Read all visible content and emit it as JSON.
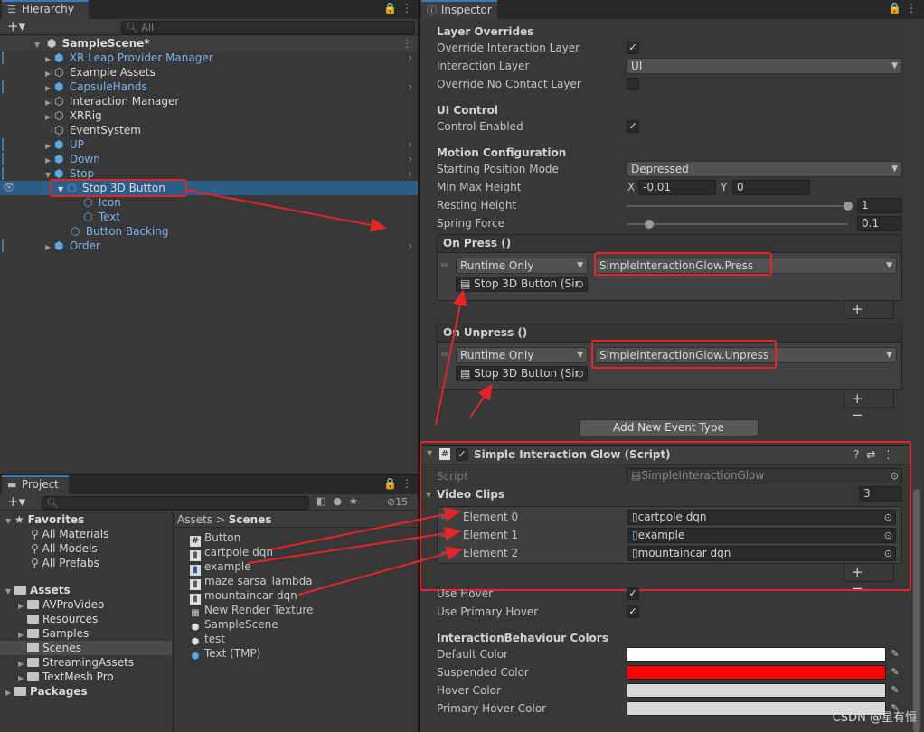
{
  "hierarchy": {
    "tab": "Hierarchy",
    "search_placeholder": "All",
    "scene": "SampleScene*",
    "items": [
      "XR Leap Provider Manager",
      "Example Assets",
      "CapsuleHands",
      "Interaction Manager",
      "XRRig",
      "EventSystem",
      "UP",
      "Down",
      "Stop",
      "Stop 3D Button",
      "Icon",
      "Text",
      "Button Backing",
      "Order"
    ]
  },
  "project": {
    "tab": "Project",
    "badge": "15",
    "favorites_label": "Favorites",
    "favorites": [
      "All Materials",
      "All Models",
      "All Prefabs"
    ],
    "assets_label": "Assets",
    "asset_folders": [
      "AVProVideo",
      "Resources",
      "Samples",
      "Scenes",
      "StreamingAssets",
      "TextMesh Pro"
    ],
    "packages_label": "Packages",
    "breadcrumb_root": "Assets",
    "breadcrumb_sep": ">",
    "breadcrumb_current": "Scenes",
    "files": [
      "Button",
      "cartpole dqn",
      "example",
      "maze sarsa_lambda",
      "mountaincar dqn",
      "New Render Texture",
      "SampleScene",
      "test",
      "Text (TMP)"
    ]
  },
  "inspector": {
    "tab": "Inspector",
    "layer_overrides": "Layer Overrides",
    "override_interaction_layer": "Override Interaction Layer",
    "interaction_layer": "Interaction Layer",
    "interaction_layer_value": "UI",
    "override_no_contact_layer": "Override No Contact Layer",
    "ui_control": "UI Control",
    "control_enabled": "Control Enabled",
    "motion_configuration": "Motion Configuration",
    "starting_position_mode": "Starting Position Mode",
    "starting_position_value": "Depressed",
    "min_max_height": "Min Max Height",
    "x_label": "X",
    "x_value": "-0.01",
    "y_label": "Y",
    "y_value": "0",
    "resting_height": "Resting Height",
    "resting_height_value": "1",
    "resting_height_fraction": 1.0,
    "spring_force": "Spring Force",
    "spring_force_value": "0.1",
    "spring_force_fraction": 0.1,
    "on_press": "On Press ()",
    "on_unpress": "On Unpress ()",
    "runtime_only": "Runtime Only",
    "press_function": "SimpleInteractionGlow.Press",
    "unpress_function": "SimpleInteractionGlow.Unpress",
    "target_object": "Stop 3D Button (Sir",
    "plus": "+",
    "minus": "−",
    "add_event_type": "Add New Event Type",
    "component_title": "Simple Interaction Glow (Script)",
    "script_label": "Script",
    "script_value": "SimpleInteractionGlow",
    "video_clips": "Video Clips",
    "video_clips_count": "3",
    "elements": [
      {
        "label": "Element 0",
        "value": "cartpole dqn"
      },
      {
        "label": "Element 1",
        "value": "example"
      },
      {
        "label": "Element 2",
        "value": "mountaincar dqn"
      }
    ],
    "use_hover": "Use Hover",
    "use_primary_hover": "Use Primary Hover",
    "colors_header": "InteractionBehaviour Colors",
    "default_color": "Default Color",
    "suspended_color": "Suspended Color",
    "hover_color": "Hover Color",
    "primary_hover_color": "Primary Hover Color",
    "colors": {
      "default": "#ffffff",
      "suspended": "#ff0000",
      "hover": "#d8d8d8",
      "primary_hover": "#d8d8d8"
    }
  },
  "watermark": "CSDN @星有恒",
  "accent": "#e4262a"
}
